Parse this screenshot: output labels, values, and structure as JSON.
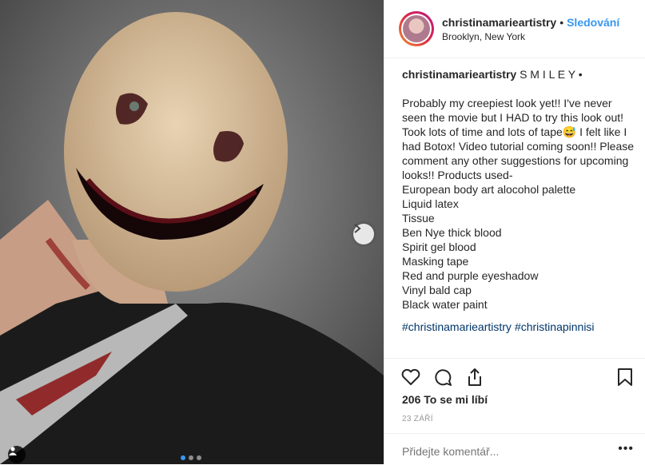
{
  "post": {
    "username": "christinamarieartistry",
    "separator": "•",
    "follow_label": "Sledování",
    "location": "Brooklyn, New York"
  },
  "caption": {
    "username": "christinamarieartistry",
    "title": "S M I L E Y •",
    "lines": [
      "Probably my creepiest look yet!! I've never seen the movie but I HAD to try this look out! Took lots of time and lots of tape😅 I felt like I had Botox! Video tutorial coming soon!! Please comment any other suggestions for upcoming looks!! Products used-",
      "European body art alocohol palette",
      "Liquid latex",
      "Tissue",
      "Ben Nye thick blood",
      "Spirit gel blood",
      "Masking tape",
      "Red and purple eyeshadow",
      "Vinyl bald cap",
      "Black water paint"
    ],
    "hashtags": [
      "#christinamarieartistry",
      "#christinapinnisi"
    ]
  },
  "actions": {
    "likes": "206",
    "likes_label": "To se mi líbí",
    "date": "23 ZÁŘÍ"
  },
  "comment": {
    "placeholder": "Přidejte komentář...",
    "more": "•••"
  },
  "carousel": {
    "current": 1,
    "total": 3
  },
  "colors": {
    "link": "#3897f0",
    "hashtag": "#003569",
    "text": "#262626",
    "muted": "#999999"
  },
  "icons": [
    "heart-icon",
    "comment-icon",
    "share-icon",
    "bookmark-icon",
    "chevron-right-icon",
    "user-tag-icon"
  ]
}
